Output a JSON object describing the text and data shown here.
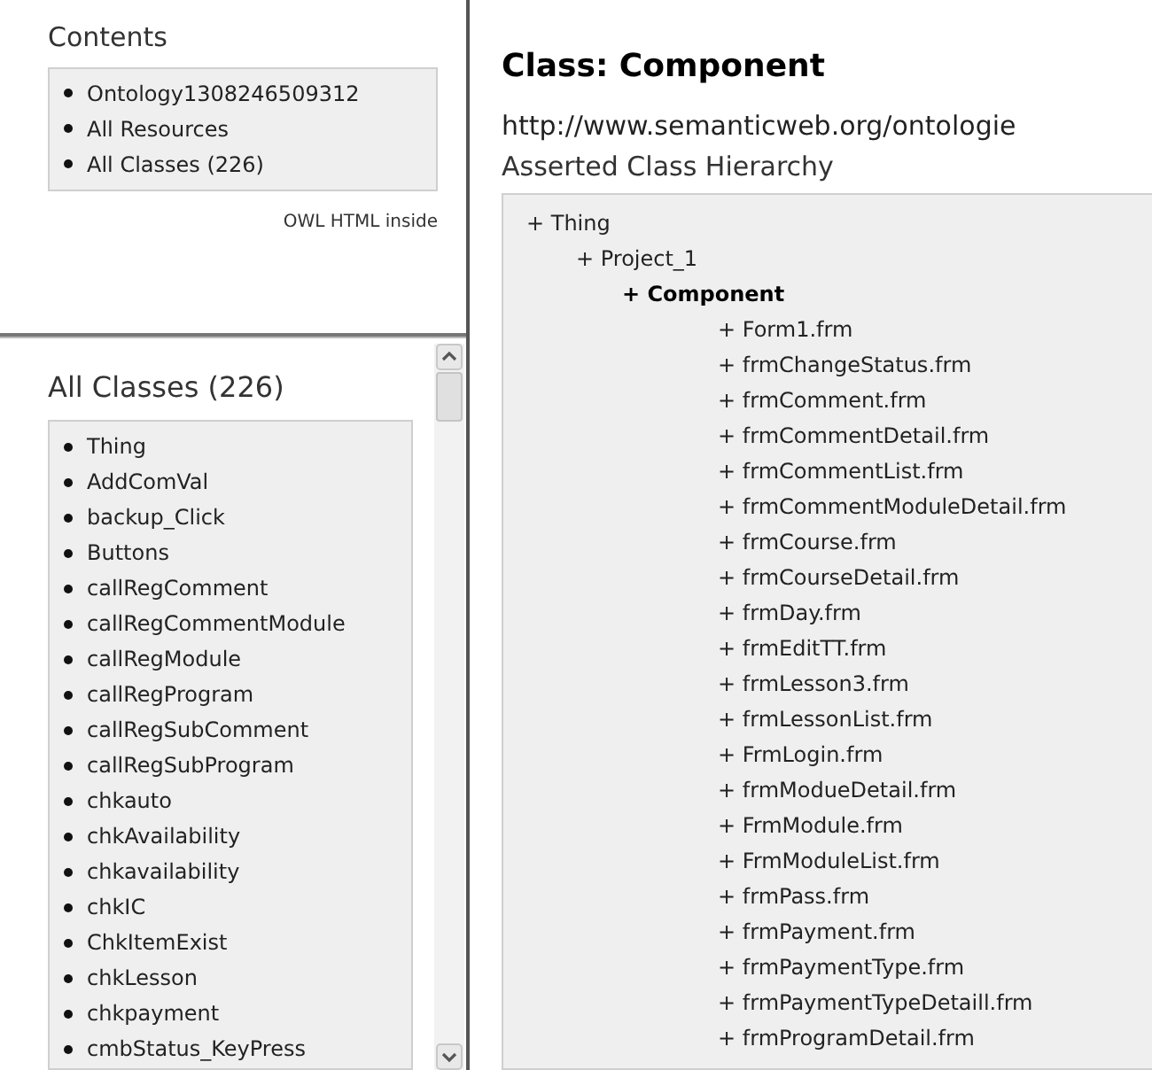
{
  "contents": {
    "title": "Contents",
    "items": [
      "Ontology1308246509312",
      "All Resources",
      "All Classes (226)"
    ],
    "footer": "OWL HTML inside"
  },
  "all_classes": {
    "title": "All Classes (226)",
    "items": [
      "Thing",
      "AddComVal",
      "backup_Click",
      "Buttons",
      "callRegComment",
      "callRegCommentModule",
      "callRegModule",
      "callRegProgram",
      "callRegSubComment",
      "callRegSubProgram",
      "chkauto",
      "chkAvailability",
      "chkavailability",
      "chkIC",
      "ChkItemExist",
      "chkLesson",
      "chkpayment",
      "cmbStatus_KeyPress"
    ]
  },
  "class_page": {
    "title": "Class: Component",
    "uri": "http://www.semanticweb.org/ontologie",
    "hierarchy_title": "Asserted Class Hierarchy",
    "hierarchy": [
      {
        "label": "+ Thing",
        "current": false,
        "children": [
          {
            "label": "+ Project_1",
            "current": false,
            "children": [
              {
                "label": "+ Component",
                "current": true,
                "children": [
                  {
                    "label": "+ Form1.frm",
                    "current": false
                  },
                  {
                    "label": "+ frmChangeStatus.frm",
                    "current": false
                  },
                  {
                    "label": "+ frmComment.frm",
                    "current": false
                  },
                  {
                    "label": "+ frmCommentDetail.frm",
                    "current": false
                  },
                  {
                    "label": "+ frmCommentList.frm",
                    "current": false
                  },
                  {
                    "label": "+ frmCommentModuleDetail.frm",
                    "current": false
                  },
                  {
                    "label": "+ frmCourse.frm",
                    "current": false
                  },
                  {
                    "label": "+ frmCourseDetail.frm",
                    "current": false
                  },
                  {
                    "label": "+ frmDay.frm",
                    "current": false
                  },
                  {
                    "label": "+ frmEditTT.frm",
                    "current": false
                  },
                  {
                    "label": "+ frmLesson3.frm",
                    "current": false
                  },
                  {
                    "label": "+ frmLessonList.frm",
                    "current": false
                  },
                  {
                    "label": "+ FrmLogin.frm",
                    "current": false
                  },
                  {
                    "label": "+ frmModueDetail.frm",
                    "current": false
                  },
                  {
                    "label": "+ FrmModule.frm",
                    "current": false
                  },
                  {
                    "label": "+ FrmModuleList.frm",
                    "current": false
                  },
                  {
                    "label": "+ frmPass.frm",
                    "current": false
                  },
                  {
                    "label": "+ frmPayment.frm",
                    "current": false
                  },
                  {
                    "label": "+ frmPaymentType.frm",
                    "current": false
                  },
                  {
                    "label": "+ frmPaymentTypeDetaill.frm",
                    "current": false
                  },
                  {
                    "label": "+ frmProgramDetail.frm",
                    "current": false
                  }
                ]
              }
            ]
          }
        ]
      }
    ]
  }
}
